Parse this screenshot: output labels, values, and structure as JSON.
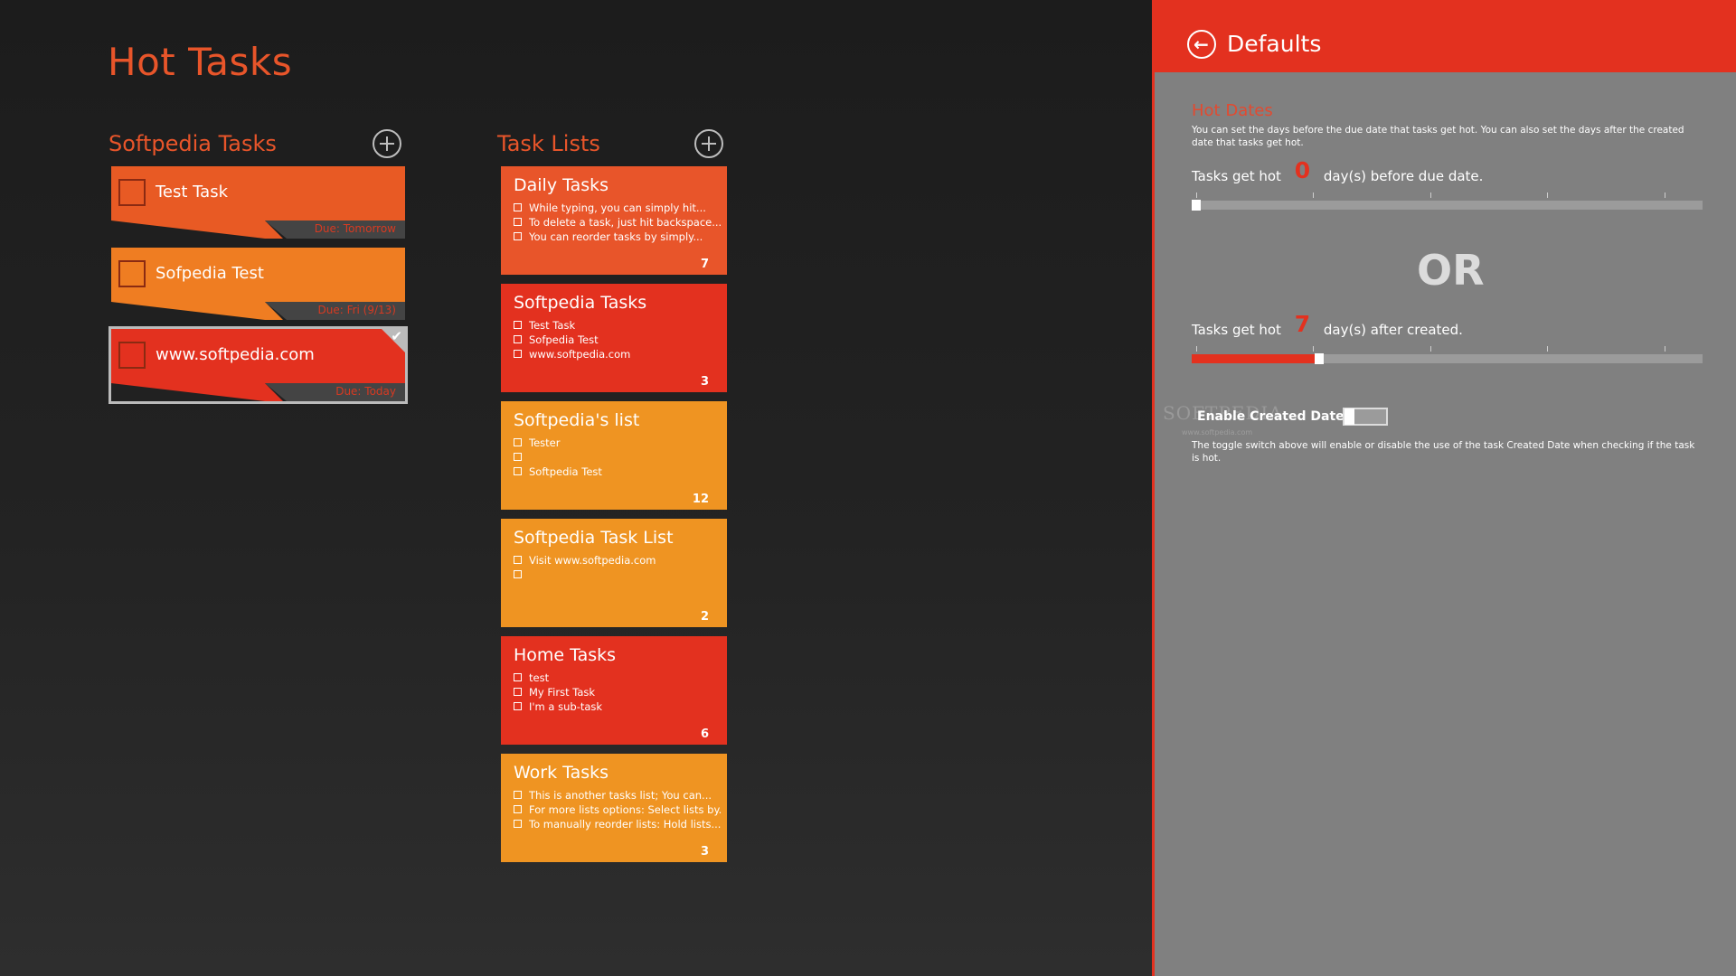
{
  "app_title": "Hot Tasks",
  "tasks_section": {
    "title": "Softpedia Tasks"
  },
  "lists_section": {
    "title": "Task Lists"
  },
  "tasks": [
    {
      "label": "Test Task",
      "due": "Due: Tomorrow",
      "color": "#e85a24",
      "selected": false
    },
    {
      "label": "Sofpedia Test",
      "due": "Due: Fri (9/13)",
      "color": "#ef7d22",
      "selected": false
    },
    {
      "label": "www.softpedia.com",
      "due": "Due: Today",
      "color": "#e3311f",
      "selected": true
    }
  ],
  "lists": [
    {
      "title": "Daily Tasks",
      "color": "#e8552a",
      "count": "7",
      "items": [
        "While typing, you can simply hit...",
        "To delete a task, just hit backspace...",
        "You can reorder tasks by simply..."
      ]
    },
    {
      "title": "Softpedia Tasks",
      "color": "#e3311f",
      "count": "3",
      "items": [
        "Test Task",
        "Sofpedia Test",
        "www.softpedia.com"
      ]
    },
    {
      "title": "Softpedia's list",
      "color": "#ef9422",
      "count": "12",
      "items": [
        "Tester",
        "",
        "Softpedia Test"
      ]
    },
    {
      "title": "Softpedia Task List",
      "color": "#ef9422",
      "count": "2",
      "items": [
        "Visit www.softpedia.com",
        ""
      ]
    },
    {
      "title": "Home Tasks",
      "color": "#e3311f",
      "count": "6",
      "items": [
        "test",
        "My First Task",
        "I'm a sub-task"
      ]
    },
    {
      "title": "Work Tasks",
      "color": "#ef9422",
      "count": "3",
      "items": [
        "This is another tasks list; You can...",
        "For more lists options: Select lists by...",
        "To manually reorder lists: Hold lists..."
      ]
    }
  ],
  "panel": {
    "title": "Defaults",
    "hot_dates_heading": "Hot Dates",
    "hot_dates_desc": "You can set the days before the due date that tasks get hot. You can also set the days after the created date that tasks get hot.",
    "before_prefix": "Tasks get hot",
    "before_value": "0",
    "before_suffix": "day(s) before due date.",
    "before_level": 0,
    "or_text": "OR",
    "after_prefix": "Tasks get hot",
    "after_value": "7",
    "after_suffix": "day(s) after created.",
    "after_level": 0.24,
    "toggle_label": "Enable Created Date",
    "toggle_on": false,
    "toggle_desc": "The toggle switch above will enable or disable the use of the task Created Date when checking if the task is hot.",
    "watermark": "SOFTPEDIA",
    "watermark_url": "www.softpedia.com"
  },
  "colors": {
    "accent": "#e3311f",
    "orange": "#e8552a",
    "amber": "#ef9422"
  }
}
